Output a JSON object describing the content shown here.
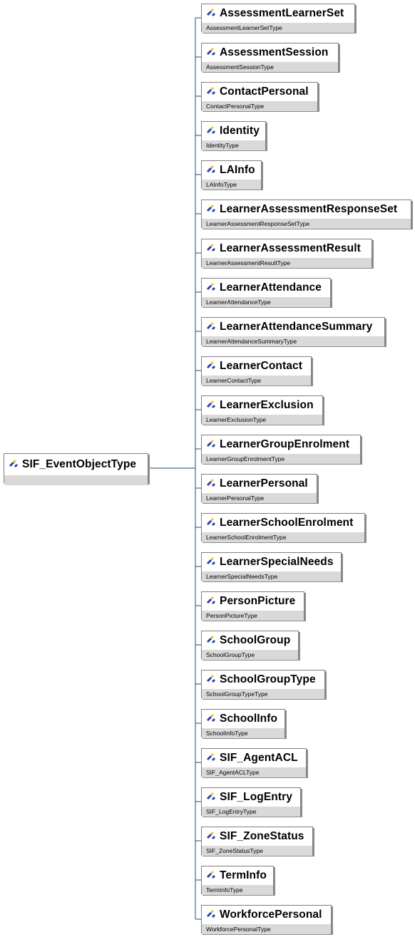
{
  "root": {
    "name": "SIF_EventObjectType",
    "type": ""
  },
  "children": [
    {
      "name": "AssessmentLearnerSet",
      "type": "AssessmentLearnerSetType"
    },
    {
      "name": "AssessmentSession",
      "type": "AssessmentSessionType"
    },
    {
      "name": "ContactPersonal",
      "type": "ContactPersonalType"
    },
    {
      "name": "Identity",
      "type": "IdentityType"
    },
    {
      "name": "LAInfo",
      "type": "LAInfoType"
    },
    {
      "name": "LearnerAssessmentResponseSet",
      "type": "LearnerAssessmentResponseSetType"
    },
    {
      "name": "LearnerAssessmentResult",
      "type": "LearnerAssessmentResultType"
    },
    {
      "name": "LearnerAttendance",
      "type": "LearnerAttendanceType"
    },
    {
      "name": "LearnerAttendanceSummary",
      "type": "LearnerAttendanceSummaryType"
    },
    {
      "name": "LearnerContact",
      "type": "LearnerContactType"
    },
    {
      "name": "LearnerExclusion",
      "type": "LearnerExclusionType"
    },
    {
      "name": "LearnerGroupEnrolment",
      "type": "LearnerGroupEnrolmentType"
    },
    {
      "name": "LearnerPersonal",
      "type": "LearnerPersonalType"
    },
    {
      "name": "LearnerSchoolEnrolment",
      "type": "LearnerSchoolEnrolmentType"
    },
    {
      "name": "LearnerSpecialNeeds",
      "type": "LearnerSpecialNeedsType"
    },
    {
      "name": "PersonPicture",
      "type": "PersonPictureType"
    },
    {
      "name": "SchoolGroup",
      "type": "SchoolGroupType"
    },
    {
      "name": "SchoolGroupType",
      "type": "SchoolGroupTypeType"
    },
    {
      "name": "SchoolInfo",
      "type": "SchoolInfoType"
    },
    {
      "name": "SIF_AgentACL",
      "type": "SIF_AgentACLType"
    },
    {
      "name": "SIF_LogEntry",
      "type": "SIF_LogEntryType"
    },
    {
      "name": "SIF_ZoneStatus",
      "type": "SIF_ZoneStatusType"
    },
    {
      "name": "TermInfo",
      "type": "TermInfoType"
    },
    {
      "name": "WorkforcePersonal",
      "type": "WorkforcePersonalType"
    }
  ],
  "colors": {
    "connector": "#1f4e79",
    "type_band": "#d9d9d9",
    "icon_blue": "#1f3fbf",
    "icon_yellow": "#f5c400"
  },
  "icon": "element-icon"
}
